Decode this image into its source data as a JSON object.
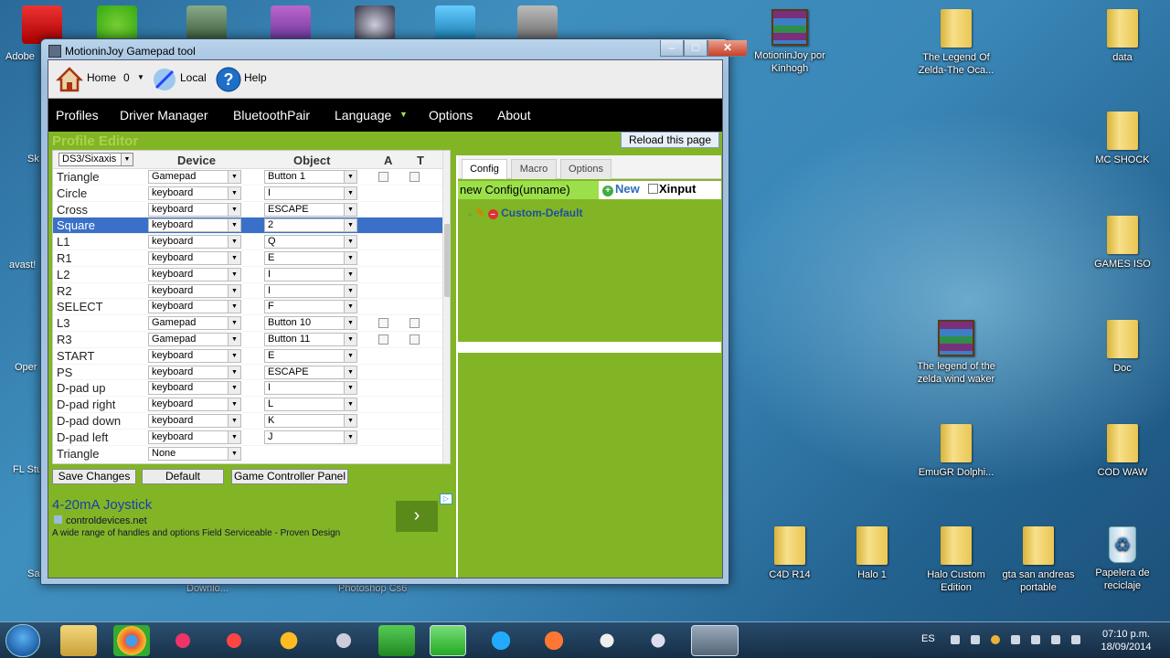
{
  "desktop": {
    "left_labels": [
      "Adobe",
      "Sk",
      "avast!",
      "Oper",
      "FL Stu",
      "Sa"
    ],
    "icons_right": [
      {
        "label": "MotioninJoy  por Kinhogh",
        "type": "archive"
      },
      {
        "label": "The Legend Of Zelda-The Oca...",
        "type": "folder"
      },
      {
        "label": "data",
        "type": "folder"
      },
      {
        "label": "MC SHOCK",
        "type": "folder"
      },
      {
        "label": "GAMES ISO",
        "type": "folder"
      },
      {
        "label": "The legend of the zelda wind waker",
        "type": "archive"
      },
      {
        "label": "Doc",
        "type": "folder"
      },
      {
        "label": "EmuGR Dolphi...",
        "type": "folder"
      },
      {
        "label": "COD WAW",
        "type": "folder"
      },
      {
        "label": "C4D R14",
        "type": "folder"
      },
      {
        "label": "Halo 1",
        "type": "folder"
      },
      {
        "label": "Halo Custom Edition",
        "type": "folder"
      },
      {
        "label": "gta san andreas portable",
        "type": "folder"
      },
      {
        "label": "Papelera de reciclaje",
        "type": "recycle-bin"
      }
    ],
    "partial_labels": [
      "Downlo...",
      "Photoshop Cs6"
    ]
  },
  "window": {
    "title": "MotioninJoy Gamepad tool",
    "controls": {
      "minimize": "–",
      "maximize": "□",
      "close": "✕"
    }
  },
  "toolbar": {
    "home_label": "Home",
    "home_value": "0",
    "local_label": "Local",
    "help_label": "Help"
  },
  "menu": [
    "Profiles",
    "Driver Manager",
    "BluetoothPair",
    "Language",
    "Options",
    "About"
  ],
  "editor": {
    "title": "Profile Editor",
    "reload_label": "Reload this page",
    "device_type": "DS3/Sixaxis",
    "columns": {
      "device": "Device",
      "object": "Object",
      "a": "A",
      "t": "T"
    },
    "rows": [
      {
        "button": "Triangle",
        "device": "Gamepad",
        "object": "Button 1",
        "checks": true
      },
      {
        "button": "Circle",
        "device": "keyboard",
        "object": "I"
      },
      {
        "button": "Cross",
        "device": "keyboard",
        "object": "ESCAPE"
      },
      {
        "button": "Square",
        "device": "keyboard",
        "object": "2",
        "selected": true
      },
      {
        "button": "L1",
        "device": "keyboard",
        "object": "Q"
      },
      {
        "button": "R1",
        "device": "keyboard",
        "object": "E"
      },
      {
        "button": "L2",
        "device": "keyboard",
        "object": "I"
      },
      {
        "button": "R2",
        "device": "keyboard",
        "object": "I"
      },
      {
        "button": "SELECT",
        "device": "keyboard",
        "object": "F"
      },
      {
        "button": "L3",
        "device": "Gamepad",
        "object": "Button 10",
        "checks": true
      },
      {
        "button": "R3",
        "device": "Gamepad",
        "object": "Button 11",
        "checks": true
      },
      {
        "button": "START",
        "device": "keyboard",
        "object": "E"
      },
      {
        "button": "PS",
        "device": "keyboard",
        "object": "ESCAPE"
      },
      {
        "button": "D-pad up",
        "device": "keyboard",
        "object": "I"
      },
      {
        "button": "D-pad right",
        "device": "keyboard",
        "object": "L"
      },
      {
        "button": "D-pad down",
        "device": "keyboard",
        "object": "K"
      },
      {
        "button": "D-pad left",
        "device": "keyboard",
        "object": "J"
      },
      {
        "button": "Triangle",
        "device": "None",
        "object": ""
      }
    ],
    "buttons": {
      "save": "Save Changes",
      "default": "Default",
      "panel": "Game Controller Panel"
    }
  },
  "ad": {
    "title": "4-20mA Joystick",
    "url": "controldevices.net",
    "description": "A wide range of handles and options Field Serviceable - Proven Design",
    "arrow": "›"
  },
  "config": {
    "tabs": [
      "Config",
      "Macro",
      "Options"
    ],
    "name": "new Config(unname)",
    "new_label": "New",
    "xinput_label": "Xinput",
    "tree_item": "Custom-Default"
  },
  "taskbar": {
    "lang": "ES",
    "time": "07:10 p.m.",
    "date": "18/09/2014"
  }
}
